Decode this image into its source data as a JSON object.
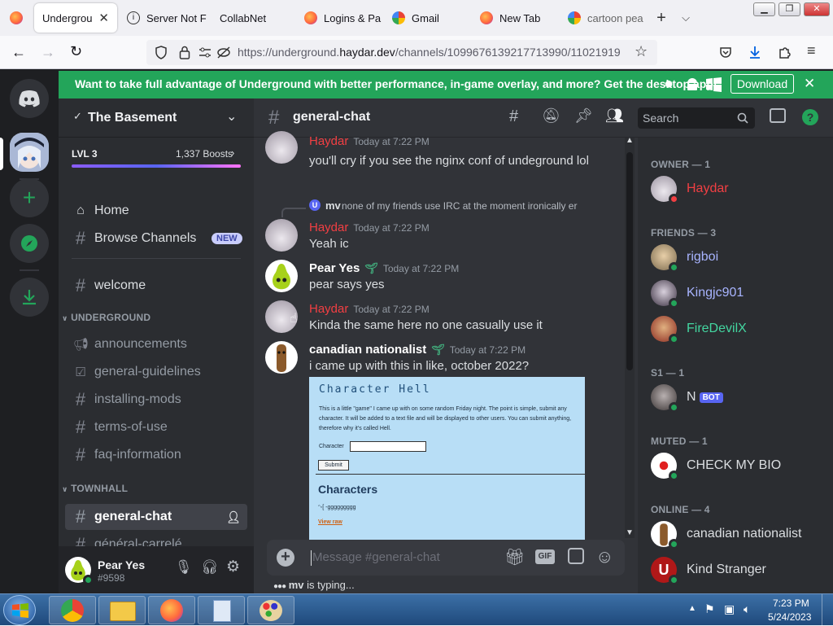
{
  "browser": {
    "tabs": [
      {
        "label": "Underground",
        "active": true,
        "icon": "firefox-icon"
      },
      {
        "label": "Server Not F",
        "icon": "info-icon"
      },
      {
        "label": "CollabNet",
        "icon": "none"
      },
      {
        "label": "Logins & Pa",
        "icon": "firefox-icon"
      },
      {
        "label": "Gmail",
        "icon": "google-icon"
      },
      {
        "label": "New Tab",
        "icon": "firefox-icon"
      },
      {
        "label": "cartoon pea",
        "icon": "google-icon"
      }
    ],
    "url_prefix": "https://underground.",
    "url_domain": "haydar.dev",
    "url_rest": "/channels/1099676139217713990/11021919"
  },
  "banner": {
    "text": "Want to take full advantage of Underground with better performance, in-game overlay, and more? Get the desktop app!",
    "button": "Download"
  },
  "server": {
    "name": "The Basement",
    "level": "LVL 3",
    "boosts": "1,337 Boosts",
    "nav": [
      {
        "label": "Home"
      },
      {
        "label": "Browse Channels",
        "badge": "NEW"
      }
    ],
    "channels_top": [
      "welcome"
    ],
    "categories": [
      {
        "name": "UNDERGROUND",
        "channels": [
          "announcements",
          "general-guidelines",
          "installing-mods",
          "terms-of-use",
          "faq-information"
        ]
      },
      {
        "name": "TOWNHALL",
        "channels": [
          "general-chat",
          "général-carrelé"
        ]
      }
    ]
  },
  "user": {
    "name": "Pear Yes",
    "tag": "#9598"
  },
  "chat": {
    "channel": "general-chat",
    "search_placeholder": "Search",
    "messages": [
      {
        "author": "Haydar",
        "time": "Today at 7:22 PM",
        "text": "you'll cry if you see the nginx conf of undeground lol",
        "color": "#f23f43"
      },
      {
        "reply_author": "mv",
        "reply_text": "none of my friends use IRC at the moment ironically er"
      },
      {
        "author": "Haydar",
        "time": "Today at 7:22 PM",
        "text": "Yeah ic",
        "color": "#f23f43"
      },
      {
        "author": "Pear Yes",
        "time": "Today at 7:22 PM",
        "text": "pear says yes",
        "color": "#ffffff"
      },
      {
        "author": "Haydar",
        "time": "Today at 7:22 PM",
        "text": "Kinda the same here no one casually use it",
        "color": "#f23f43"
      },
      {
        "author": "canadian nationalist",
        "time": "Today at 7:22 PM",
        "text": "i came up with this in like, october 2022?",
        "color": "#ffffff"
      }
    ],
    "embed": {
      "title": "Character Hell",
      "desc": "This is a little \"game\" I came up with on some random Friday night. The point is simple, submit any character. It will be added to a text file and will be displayed to other users. You can submit anything, therefore why it's called Hell.",
      "field_label": "Character",
      "submit": "Submit",
      "heading": "Characters",
      "chars": "ᵔᵕ[ -ggggggggg",
      "link": "View raw"
    },
    "input_placeholder": "Message #general-chat",
    "typing_user": "mv",
    "typing_suffix": " is typing..."
  },
  "members": {
    "sections": [
      {
        "title": "OWNER — 1",
        "items": [
          {
            "name": "Haydar",
            "color": "#f23f43",
            "status": "dnd"
          }
        ]
      },
      {
        "title": "FRIENDS — 3",
        "items": [
          {
            "name": "rigboi",
            "color": "#a8b4ff",
            "status": "online"
          },
          {
            "name": "Kingjc901",
            "color": "#a8b4ff",
            "status": "online"
          },
          {
            "name": "FireDevilX",
            "color": "#43d6a0",
            "status": "online"
          }
        ]
      },
      {
        "title": "S1 — 1",
        "items": [
          {
            "name": "N",
            "color": "#dbdee1",
            "status": "online",
            "badge": "BOT"
          }
        ]
      },
      {
        "title": "MUTED — 1",
        "items": [
          {
            "name": "CHECK MY BIO",
            "color": "#dbdee1",
            "status": "online"
          }
        ]
      },
      {
        "title": "ONLINE — 4",
        "items": [
          {
            "name": "canadian nationalist",
            "color": "#dbdee1",
            "status": "online"
          },
          {
            "name": "Kind Stranger",
            "color": "#dbdee1",
            "status": "online"
          }
        ]
      }
    ]
  },
  "taskbar": {
    "time": "7:23 PM",
    "date": "5/24/2023"
  }
}
